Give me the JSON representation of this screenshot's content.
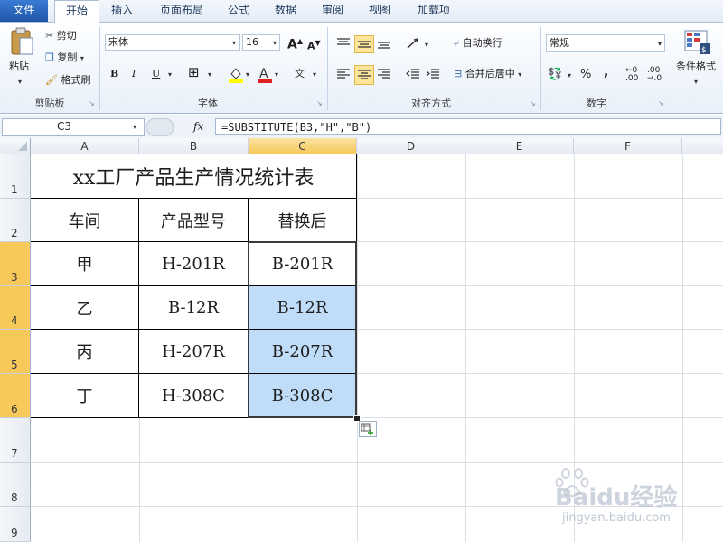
{
  "ribbon_tabs": [
    "文件",
    "开始",
    "插入",
    "页面布局",
    "公式",
    "数据",
    "审阅",
    "视图",
    "加载项"
  ],
  "clipboard": {
    "paste": "粘贴",
    "cut": "剪切",
    "copy": "复制",
    "format_painter": "格式刷",
    "group": "剪贴板"
  },
  "font": {
    "name": "宋体",
    "size": "16",
    "group": "字体"
  },
  "alignment": {
    "wrap": "自动换行",
    "merge": "合并后居中",
    "group": "对齐方式"
  },
  "number": {
    "format": "常规",
    "percent": "%",
    "comma": ",",
    "group": "数字"
  },
  "styles": {
    "conditional": "条件格式"
  },
  "formula_bar": {
    "cell_ref": "C3",
    "fx": "fx",
    "formula": "=SUBSTITUTE(B3,\"H\",\"B\")"
  },
  "columns": [
    "A",
    "B",
    "C",
    "D",
    "E",
    "F"
  ],
  "rows": [
    "1",
    "2",
    "3",
    "4",
    "5",
    "6",
    "7",
    "8",
    "9"
  ],
  "table": {
    "title": "xx工厂产品生产情况统计表",
    "headers": [
      "车间",
      "产品型号",
      "替换后"
    ],
    "rows": [
      [
        "甲",
        "H-201R",
        "B-201R"
      ],
      [
        "乙",
        "B-12R",
        "B-12R"
      ],
      [
        "丙",
        "H-207R",
        "B-207R"
      ],
      [
        "丁",
        "H-308C",
        "B-308C"
      ]
    ]
  },
  "watermark": {
    "brand": "Baidu经验",
    "url": "jingyan.baidu.com"
  },
  "colors": {
    "selection": "#bfdcf8",
    "active_header": "#f6c95a"
  }
}
